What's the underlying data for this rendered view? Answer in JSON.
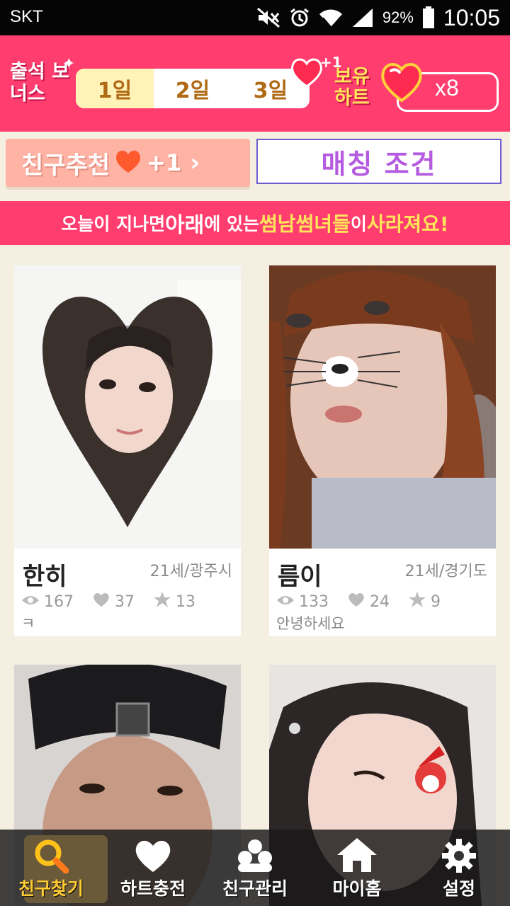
{
  "status_bar": {
    "carrier": "SKT",
    "battery": "92%",
    "time": "10:05"
  },
  "attendance": {
    "title": "출석 보너스",
    "days": [
      "1일",
      "2일",
      "3일"
    ],
    "heart_bonus": "+1",
    "owned_label": "보유 하트",
    "owned_count": "x8"
  },
  "recommend": {
    "label": "친구추천",
    "bonus": "+1"
  },
  "matching": {
    "label": "매칭 조건"
  },
  "notice": {
    "part1": "오늘이 지나면 ",
    "part2": "아래",
    "part3": "에 있는 ",
    "part4": "썸남썸녀들",
    "part5": "이 ",
    "part6": "사라져요!"
  },
  "cards": [
    {
      "name": "한히",
      "meta": "21세/광주시",
      "views": "167",
      "hearts": "37",
      "stars": "13",
      "message": "ㅋ"
    },
    {
      "name": "름이",
      "meta": "21세/경기도",
      "views": "133",
      "hearts": "24",
      "stars": "9",
      "message": "안녕하세요"
    },
    {
      "name": "",
      "meta": "",
      "views": "",
      "hearts": "",
      "stars": "",
      "message": ""
    },
    {
      "name": "",
      "meta": "",
      "views": "",
      "hearts": "",
      "stars": "",
      "message": ""
    }
  ],
  "nav": [
    {
      "label": "친구찾기",
      "icon": "search-icon",
      "active": true
    },
    {
      "label": "하트충전",
      "icon": "heart-icon"
    },
    {
      "label": "친구관리",
      "icon": "people-icon"
    },
    {
      "label": "마이홈",
      "icon": "home-icon"
    },
    {
      "label": "설정",
      "icon": "gear-icon"
    }
  ],
  "colors": {
    "pink": "#ff3d6e",
    "yellow": "#ffe45a",
    "beige": "#f5efe2",
    "purple": "#b55be0"
  }
}
